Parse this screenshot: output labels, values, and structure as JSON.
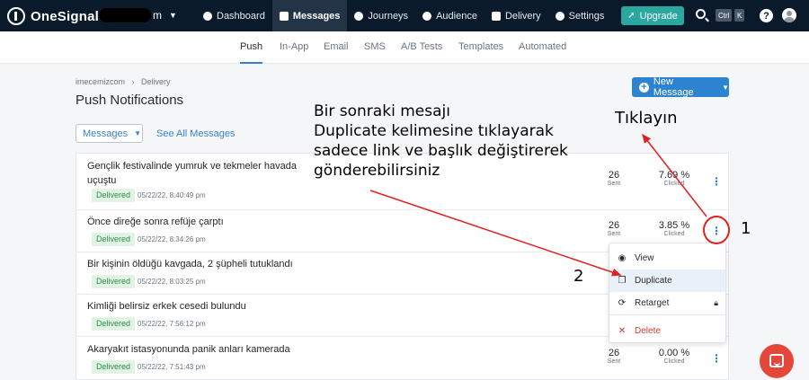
{
  "topbar": {
    "brand": "OneSignal",
    "org_tail": "m",
    "nav": [
      {
        "label": "Dashboard",
        "icon": "dashboard-icon"
      },
      {
        "label": "Messages",
        "icon": "chat-icon"
      },
      {
        "label": "Journeys",
        "icon": "journeys-icon"
      },
      {
        "label": "Audience",
        "icon": "audience-icon"
      },
      {
        "label": "Delivery",
        "icon": "delivery-icon"
      },
      {
        "label": "Settings",
        "icon": "gear-icon"
      }
    ],
    "upgrade_label": "Upgrade",
    "kbd_ctrl": "Ctrl",
    "kbd_k": "K",
    "help": "?"
  },
  "subnav": [
    "Push",
    "In-App",
    "Email",
    "SMS",
    "A/B Tests",
    "Templates",
    "Automated"
  ],
  "breadcrumb": {
    "root": "imecemizcom",
    "sep": "›",
    "current": "Delivery"
  },
  "page_title": "Push Notifications",
  "new_message_label": "New Message",
  "messages_dropdown_label": "Messages",
  "see_all_label": "See All Messages",
  "rows": [
    {
      "title": "Gençlik festivalinde yumruk ve tekmeler havada uçuştu",
      "status": "Delivered",
      "date": "05/22/22, 8:40:49 pm",
      "sent": "26",
      "sent_label": "Sent",
      "clicked": "7.69 %",
      "clicked_label": "Clicked"
    },
    {
      "title": "Önce direğe sonra refüje çarptı",
      "status": "Delivered",
      "date": "05/22/22, 8:34:26 pm",
      "sent": "26",
      "sent_label": "Sent",
      "clicked": "3.85 %",
      "clicked_label": "Clicked"
    },
    {
      "title": "Bir kişinin öldüğü kavgada, 2 şüpheli tutuklandı",
      "status": "Delivered",
      "date": "05/22/22, 8:03:25 pm"
    },
    {
      "title": "Kimliği belirsiz erkek cesedi bulundu",
      "status": "Delivered",
      "date": "05/22/22, 7:56:12 pm"
    },
    {
      "title": "Akaryakıt istasyonunda panik anları kamerada",
      "status": "Delivered",
      "date": "05/22/22, 7:51:43 pm",
      "sent": "26",
      "sent_label": "Sent",
      "clicked": "0.00 %",
      "clicked_label": "Clicked"
    }
  ],
  "menu": {
    "view": "View",
    "duplicate": "Duplicate",
    "retarget": "Retarget",
    "delete": "Delete"
  },
  "annotations": {
    "main_lines": [
      "Bir sonraki mesajı",
      "Duplicate kelimesine tıklayarak",
      "sadece link ve başlık değiştirerek",
      "gönderebilirsiniz"
    ],
    "click_here": "Tıklayın",
    "step1": "1",
    "step2": "2"
  },
  "colors": {
    "topbar": "#0b1a2a",
    "accent": "#2d83cf",
    "upgrade": "#2aa8a0",
    "annotation_red": "#e0211f",
    "delivered_green": "#2e8c46",
    "chat": "#e5463a"
  }
}
